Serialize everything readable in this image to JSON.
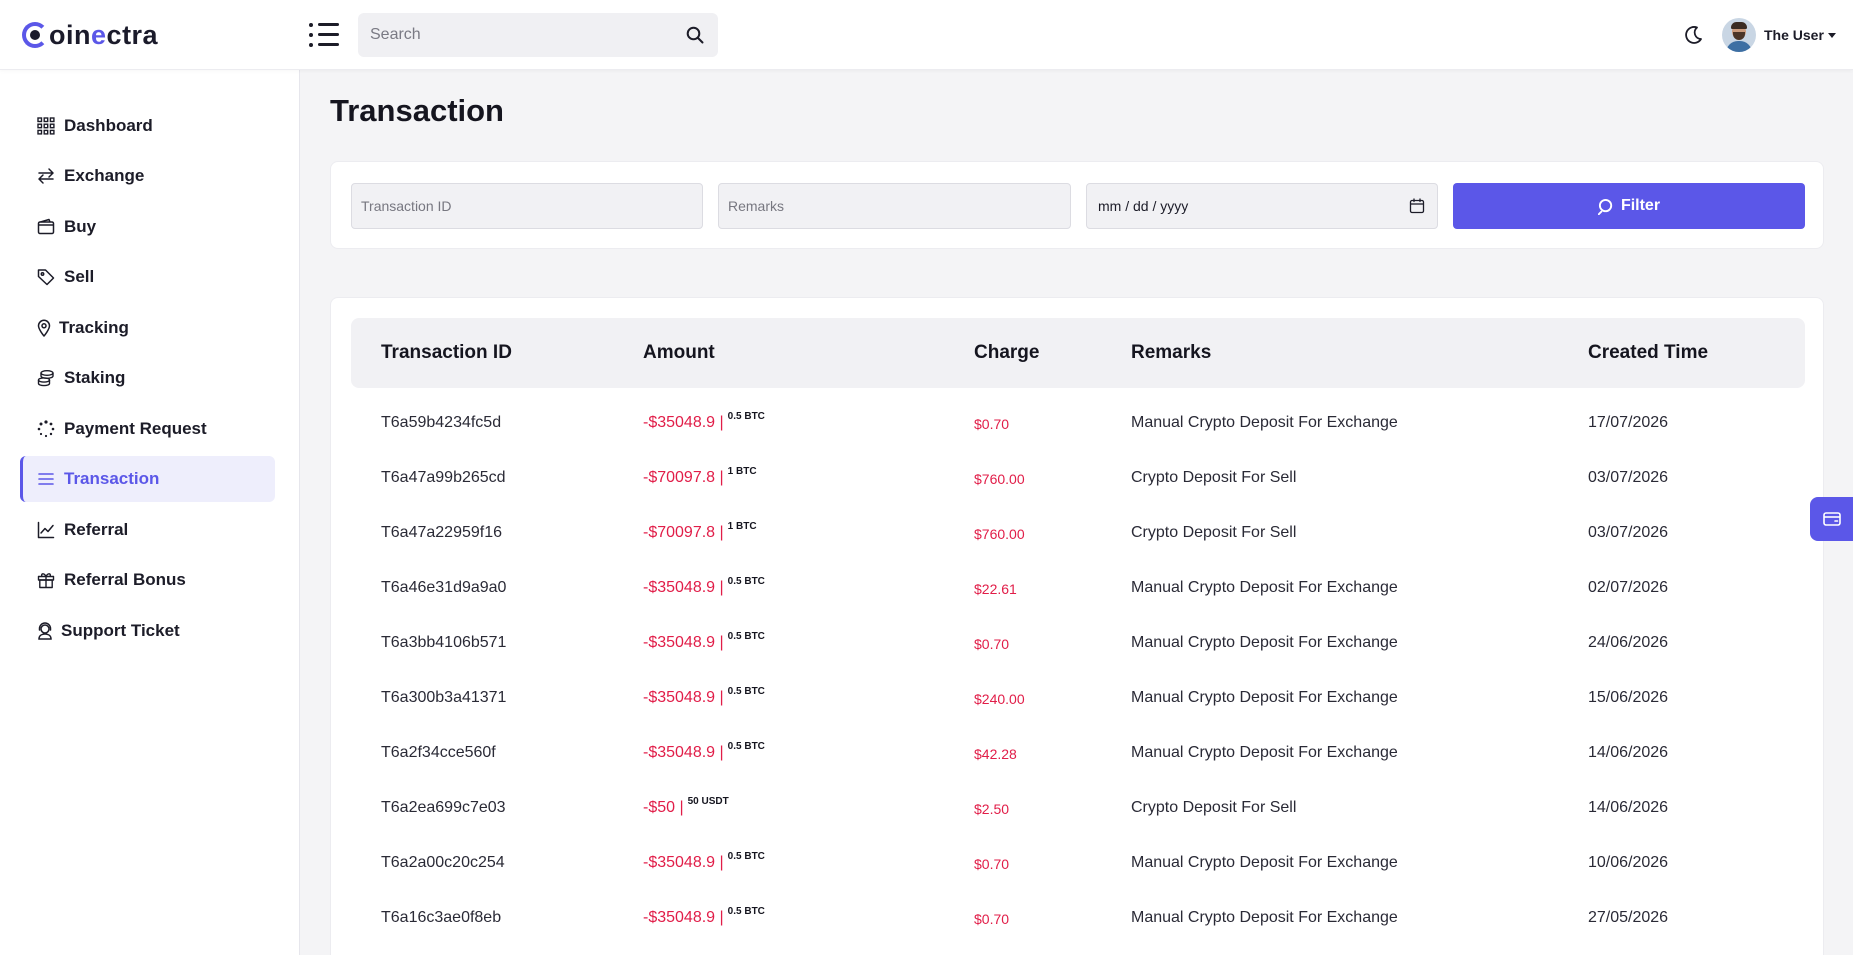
{
  "brand": {
    "name_prefix": "oin",
    "name_accent": "e",
    "name_middle": "c",
    "name_suffix": "tra",
    "accent_color": "#5b57e8"
  },
  "header": {
    "search_placeholder": "Search",
    "user_name": "The User"
  },
  "sidebar": {
    "items": [
      {
        "label": "Dashboard",
        "icon": "grid-icon"
      },
      {
        "label": "Exchange",
        "icon": "swap-icon"
      },
      {
        "label": "Buy",
        "icon": "wallet-icon"
      },
      {
        "label": "Sell",
        "icon": "tag-icon"
      },
      {
        "label": "Tracking",
        "icon": "location-pin-icon"
      },
      {
        "label": "Staking",
        "icon": "coins-icon"
      },
      {
        "label": "Payment Request",
        "icon": "spinner-icon"
      },
      {
        "label": "Transaction",
        "icon": "list-icon",
        "active": true
      },
      {
        "label": "Referral",
        "icon": "chart-line-icon"
      },
      {
        "label": "Referral Bonus",
        "icon": "gift-icon"
      },
      {
        "label": "Support Ticket",
        "icon": "support-agent-icon"
      }
    ]
  },
  "page": {
    "title": "Transaction"
  },
  "filters": {
    "transaction_id_placeholder": "Transaction ID",
    "remarks_placeholder": "Remarks",
    "date_placeholder": "mm / dd / yyyy",
    "filter_label": "Filter"
  },
  "table": {
    "columns": [
      "Transaction ID",
      "Amount",
      "Charge",
      "Remarks",
      "Created Time"
    ],
    "rows": [
      {
        "id": "T6a59b4234fc5d",
        "amount": "-$35048.9 |",
        "qty": "0.5 BTC",
        "charge": "$0.70",
        "remarks": "Manual Crypto Deposit For Exchange",
        "created": "17/07/2026"
      },
      {
        "id": "T6a47a99b265cd",
        "amount": "-$70097.8 |",
        "qty": "1 BTC",
        "charge": "$760.00",
        "remarks": "Crypto Deposit For Sell",
        "created": "03/07/2026"
      },
      {
        "id": "T6a47a22959f16",
        "amount": "-$70097.8 |",
        "qty": "1 BTC",
        "charge": "$760.00",
        "remarks": "Crypto Deposit For Sell",
        "created": "03/07/2026"
      },
      {
        "id": "T6a46e31d9a9a0",
        "amount": "-$35048.9 |",
        "qty": "0.5 BTC",
        "charge": "$22.61",
        "remarks": "Manual Crypto Deposit For Exchange",
        "created": "02/07/2026"
      },
      {
        "id": "T6a3bb4106b571",
        "amount": "-$35048.9 |",
        "qty": "0.5 BTC",
        "charge": "$0.70",
        "remarks": "Manual Crypto Deposit For Exchange",
        "created": "24/06/2026"
      },
      {
        "id": "T6a300b3a41371",
        "amount": "-$35048.9 |",
        "qty": "0.5 BTC",
        "charge": "$240.00",
        "remarks": "Manual Crypto Deposit For Exchange",
        "created": "15/06/2026"
      },
      {
        "id": "T6a2f34cce560f",
        "amount": "-$35048.9 |",
        "qty": "0.5 BTC",
        "charge": "$42.28",
        "remarks": "Manual Crypto Deposit For Exchange",
        "created": "14/06/2026"
      },
      {
        "id": "T6a2ea699c7e03",
        "amount": "-$50 |",
        "qty": "50 USDT",
        "charge": "$2.50",
        "remarks": "Crypto Deposit For Sell",
        "created": "14/06/2026"
      },
      {
        "id": "T6a2a00c20c254",
        "amount": "-$35048.9 |",
        "qty": "0.5 BTC",
        "charge": "$0.70",
        "remarks": "Manual Crypto Deposit For Exchange",
        "created": "10/06/2026"
      },
      {
        "id": "T6a16c3ae0f8eb",
        "amount": "-$35048.9 |",
        "qty": "0.5 BTC",
        "charge": "$0.70",
        "remarks": "Manual Crypto Deposit For Exchange",
        "created": "27/05/2026"
      }
    ]
  }
}
